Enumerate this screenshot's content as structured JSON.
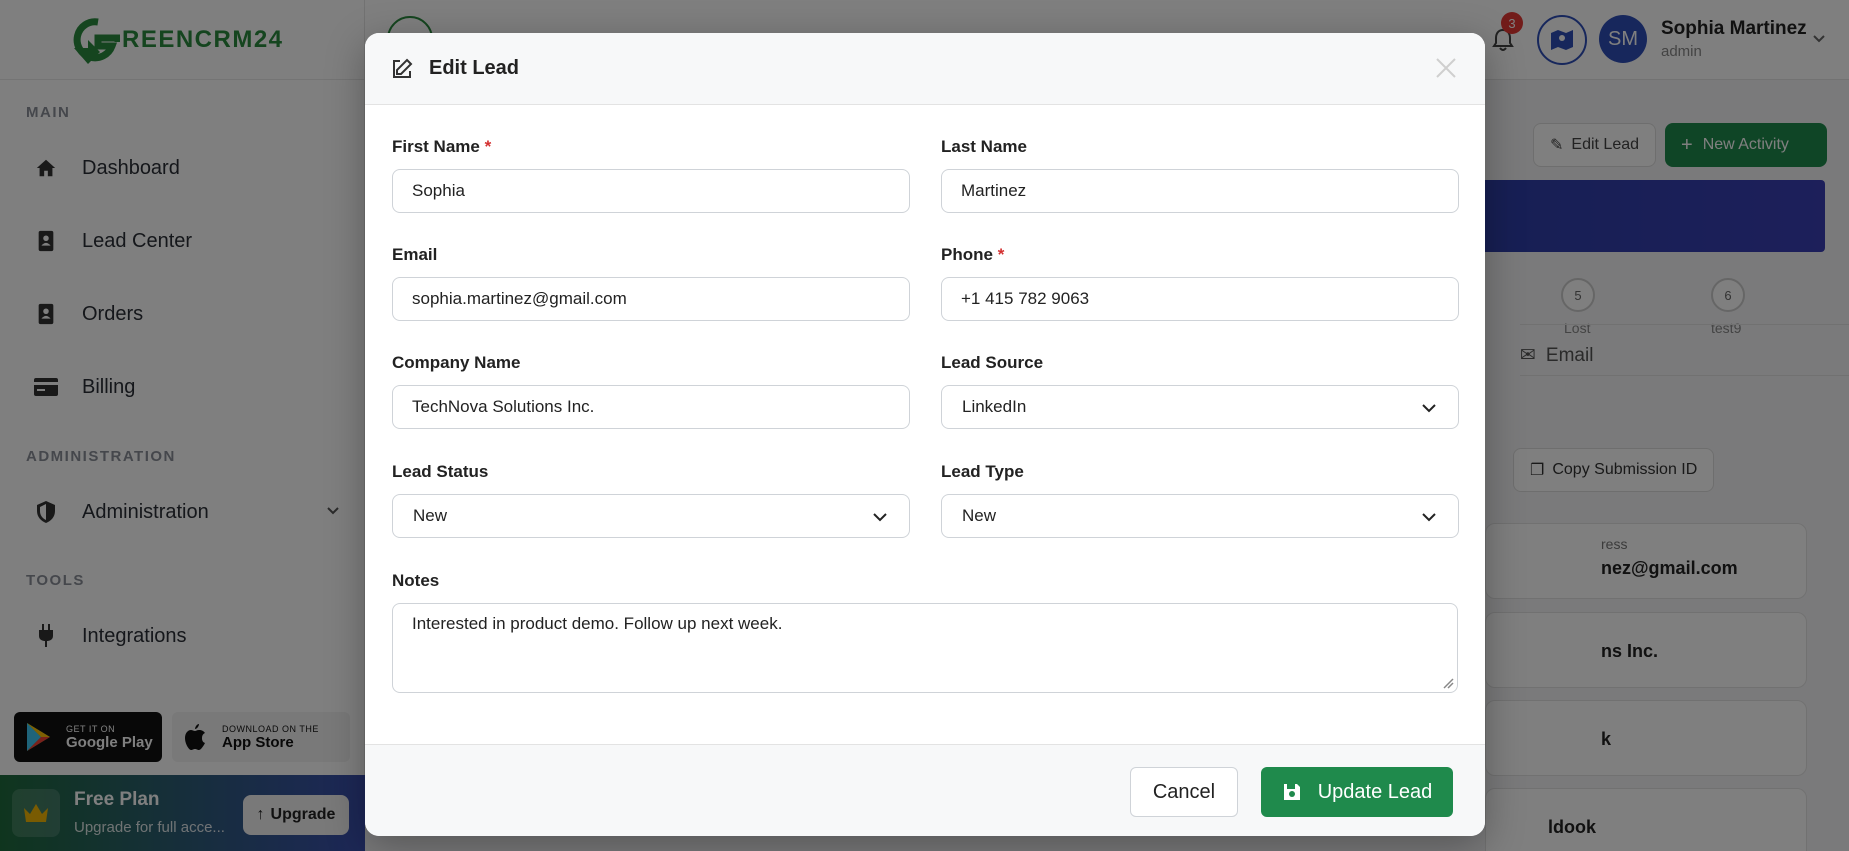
{
  "brand": {
    "logo_text": "REENCRM24"
  },
  "sidebar": {
    "sections": [
      {
        "label": "MAIN"
      },
      {
        "label": "ADMINISTRATION"
      },
      {
        "label": "TOOLS"
      }
    ],
    "items": [
      {
        "label": "Dashboard",
        "icon": "home-icon"
      },
      {
        "label": "Lead Center",
        "icon": "contact-book-icon"
      },
      {
        "label": "Orders",
        "icon": "order-book-icon"
      },
      {
        "label": "Billing",
        "icon": "credit-card-icon"
      },
      {
        "label": "Administration",
        "icon": "shield-icon"
      },
      {
        "label": "Integrations",
        "icon": "plug-icon"
      }
    ],
    "google_play": {
      "small": "GET IT ON",
      "big": "Google Play"
    },
    "app_store": {
      "small": "DOWNLOAD ON THE",
      "big": "App Store"
    },
    "plan": {
      "title": "Free Plan",
      "subtitle": "Upgrade for full acce...",
      "upgrade_label": "Upgrade"
    }
  },
  "topbar": {
    "notification_count": "3",
    "avatar_initials": "SM",
    "user_name": "Sophia Martinez",
    "user_role": "admin"
  },
  "background": {
    "edit_lead_label": "Edit Lead",
    "new_activity_label": "New Activity",
    "steps": [
      {
        "num": "5",
        "label": "Lost"
      },
      {
        "num": "6",
        "label": "test9"
      }
    ],
    "email_tab": "Email",
    "copy_submission_label": "Copy Submission ID",
    "card_email_label": "ress",
    "card_email_value": "nez@gmail.com",
    "card_company_value": "ns Inc.",
    "card_source_value": "k",
    "card_bottom_value": "ldook"
  },
  "modal": {
    "title": "Edit Lead",
    "fields": {
      "first_name": {
        "label": "First Name",
        "required": "*",
        "value": "Sophia"
      },
      "last_name": {
        "label": "Last Name",
        "value": "Martinez"
      },
      "email": {
        "label": "Email",
        "value": "sophia.martinez@gmail.com"
      },
      "phone": {
        "label": "Phone",
        "required": "*",
        "value": "+1 415 782 9063"
      },
      "company": {
        "label": "Company Name",
        "value": "TechNova Solutions Inc."
      },
      "lead_source": {
        "label": "Lead Source",
        "value": "LinkedIn"
      },
      "lead_status": {
        "label": "Lead Status",
        "value": "New"
      },
      "lead_type": {
        "label": "Lead Type",
        "value": "New"
      },
      "notes": {
        "label": "Notes",
        "value": "Interested in product demo. Follow up next week."
      }
    },
    "cancel_label": "Cancel",
    "update_label": "Update Lead"
  },
  "colors": {
    "brand_green": "#2a8a3e",
    "primary_button": "#1f8a4c",
    "accent_blue": "#2f4fb8",
    "required_red": "#d32f2f"
  }
}
